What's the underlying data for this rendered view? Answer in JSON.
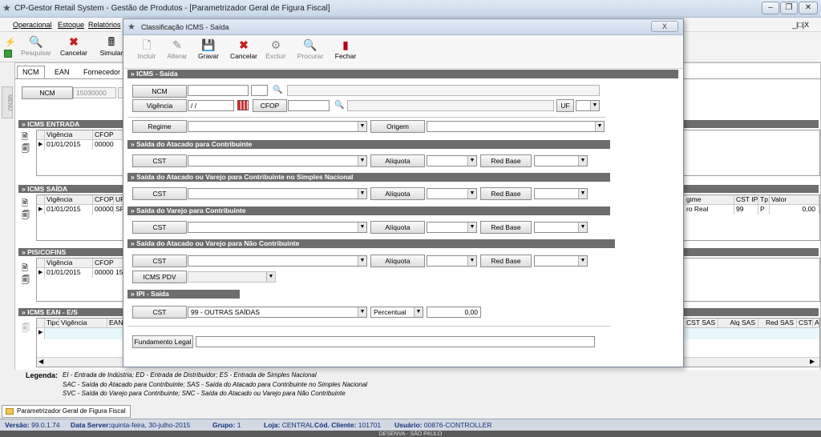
{
  "window": {
    "title": "CP-Gestor Retail System - Gestão de Produtos - [Parametrizador Geral de Figura Fiscal]"
  },
  "menu": {
    "items": [
      "Operacional",
      "Estoque",
      "Relatórios"
    ],
    "mdi_controls": "_|&#|X"
  },
  "toolbar": {
    "buttons": [
      "Pesquisar",
      "Cancelar",
      "Simular"
    ]
  },
  "side_label": "MENU",
  "tabs": [
    "NCM",
    "EAN",
    "Fornecedor"
  ],
  "ncm_filter": {
    "label": "NCM",
    "value": "15030000"
  },
  "icms_entrada": {
    "title": "» ICMS ENTRADA",
    "columns": [
      "Vigência",
      "CFOP"
    ],
    "rows": [
      [
        "01/01/2015",
        "00000"
      ]
    ]
  },
  "icms_saida": {
    "title": "» ICMS SAÍDA",
    "columns": [
      "Vigência",
      "CFOP",
      "UF"
    ],
    "rows": [
      [
        "01/01/2015",
        "00000",
        "SP"
      ]
    ],
    "right_columns": [
      "gime",
      "CST IPI",
      "Tp",
      "Valor"
    ],
    "right_rows": [
      [
        "ro Real",
        "99",
        "P",
        "0,00"
      ]
    ]
  },
  "pis_cofins": {
    "title": "» PIS/COFINS",
    "columns": [
      "Vigência",
      "CFOP"
    ],
    "rows": [
      [
        "01/01/2015",
        "00000 15"
      ]
    ]
  },
  "icms_ean": {
    "title": "» ICMS EAN - E/S",
    "columns": [
      "Tipo",
      "Vigência",
      "EAN"
    ],
    "right_columns": [
      "CST SAS",
      "Alq SAS",
      "Red SAS",
      "CST SVC",
      "A"
    ]
  },
  "legend": {
    "label": "Legenda:",
    "lines": [
      "EI - Entrada de Indústria;  ED - Entrada de Distribuidor;  ES - Entrada de Simples Nacional",
      "SAC - Saída do Atacado para Contribuinte;  SAS - Saída do Atacado para Contribuinte no Simples Nacional",
      "SVC - Saída do Varejo para Contribuinte;  SNC - Saída do Atacado ou Varejo para Não Contribuinte"
    ]
  },
  "taskbar": {
    "tab": "Parametrizador Geral de Figura Fiscal"
  },
  "status": {
    "versao_label": "Versão:",
    "versao": "99.0.1.74",
    "server_label": "Data Server:",
    "server": "quinta-feira, 30-julho-2015",
    "grupo_label": "Grupo:",
    "grupo": "1",
    "loja_label": "Loja:",
    "loja": "CENTRAL",
    "cliente_label": "Cód. Cliente:",
    "cliente": "101701",
    "usuario_label": "Usuário:",
    "usuario": "00876-CONTROLLER",
    "bottom": "DESENVA - SÃO PAULO"
  },
  "dialog": {
    "title": "Classificação ICMS - Saída",
    "close": "X",
    "toolbar": [
      "Incluir",
      "Alterar",
      "Gravar",
      "Cancelar",
      "Excluir",
      "Procurar",
      "Fechar"
    ],
    "sec_icms": "» ICMS - Saída",
    "ncm_label": "NCM",
    "vigencia_label": "Vigência",
    "vigencia_value": " / /",
    "cfop_label": "CFOP",
    "uf_label": "UF",
    "regime_label": "Regime",
    "origem_label": "Origem",
    "sec1": "» Saída do Atacado para Contribuinte",
    "sec2": "» Saída do Atacado ou Varejo para Contribuinte no Simples Nacional",
    "sec3": "» Saída do Varejo para Contribuinte",
    "sec4": "» Saída do Atacado ou Varejo para Não Contribuinte",
    "cst_label": "CST",
    "aliquota_label": "Alíquota",
    "redbase_label": "Red Base",
    "icms_pdv_label": "ICMS PDV",
    "sec_ipi": "» IPI - Saída",
    "ipi_cst_value": "99 - OUTRAS SAÍDAS",
    "ipi_tipo_value": "Percentual",
    "ipi_valor": "0,00",
    "fundamento_label": "Fundamento Legal"
  },
  "colors": {
    "section_header": "#6d6d6d",
    "status_text": "#14307a"
  }
}
